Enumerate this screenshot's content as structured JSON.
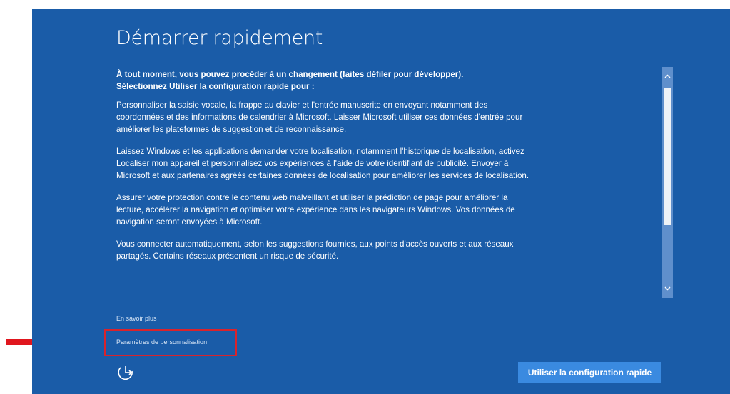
{
  "page": {
    "title": "Démarrer rapidement"
  },
  "content": {
    "intro_line1": "À tout moment, vous pouvez procéder à un changement (faites défiler pour développer).",
    "intro_line2": "Sélectionnez Utiliser la configuration rapide pour :",
    "paragraphs": [
      "Personnaliser la saisie vocale, la frappe au clavier et l'entrée manuscrite en envoyant notamment des coordonnées et des informations de calendrier à Microsoft. Laisser Microsoft utiliser ces données d'entrée pour améliorer les plateformes de suggestion et de reconnaissance.",
      "Laissez Windows et les applications demander votre localisation, notamment l'historique de localisation, activez Localiser mon appareil et personnalisez vos expériences à l'aide de votre identifiant de publicité. Envoyer à Microsoft et aux partenaires agréés certaines données de localisation pour améliorer les services de localisation.",
      "Assurer votre protection contre le contenu web malveillant et utiliser la prédiction de page pour améliorer la lecture, accélérer la navigation et optimiser votre expérience dans les navigateurs Windows. Vos données de navigation seront envoyées à Microsoft.",
      "Vous connecter automatiquement, selon les suggestions fournies, aux points d'accès ouverts et aux réseaux partagés. Certains réseaux présentent un risque de sécurité."
    ]
  },
  "links": {
    "learn_more": "En savoir plus",
    "personalization_settings": "Paramètres de personnalisation"
  },
  "buttons": {
    "express_settings": "Utiliser la configuration rapide"
  },
  "icons": {
    "scroll_up": "chevron-up-icon",
    "scroll_down": "chevron-down-icon",
    "accessibility": "ease-of-access-icon",
    "annotation_arrow": "red-arrow-icon"
  },
  "colors": {
    "background": "#1a5ca8",
    "button": "#3a8ae0",
    "highlight": "#d9232c",
    "arrow": "#e0161e"
  }
}
